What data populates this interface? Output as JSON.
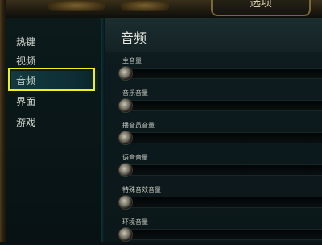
{
  "window": {
    "title": "选项"
  },
  "sidebar": {
    "items": [
      {
        "label": "热键",
        "active": false
      },
      {
        "label": "视频",
        "active": false
      },
      {
        "label": "音频",
        "active": true
      },
      {
        "label": "界面",
        "active": false
      },
      {
        "label": "游戏",
        "active": false
      }
    ]
  },
  "panel": {
    "title": "音频",
    "settings": [
      {
        "label": "主音量",
        "value": 0
      },
      {
        "label": "音乐音量",
        "value": 0
      },
      {
        "label": "播音员音量",
        "value": 0
      },
      {
        "label": "语音音量",
        "value": 0
      },
      {
        "label": "特殊音效音量",
        "value": 0
      },
      {
        "label": "环境音量",
        "value": 0
      }
    ]
  },
  "colors": {
    "highlight": "#f2f01a",
    "active_tab": "#123a40",
    "gold_frame": "#7a6836"
  }
}
